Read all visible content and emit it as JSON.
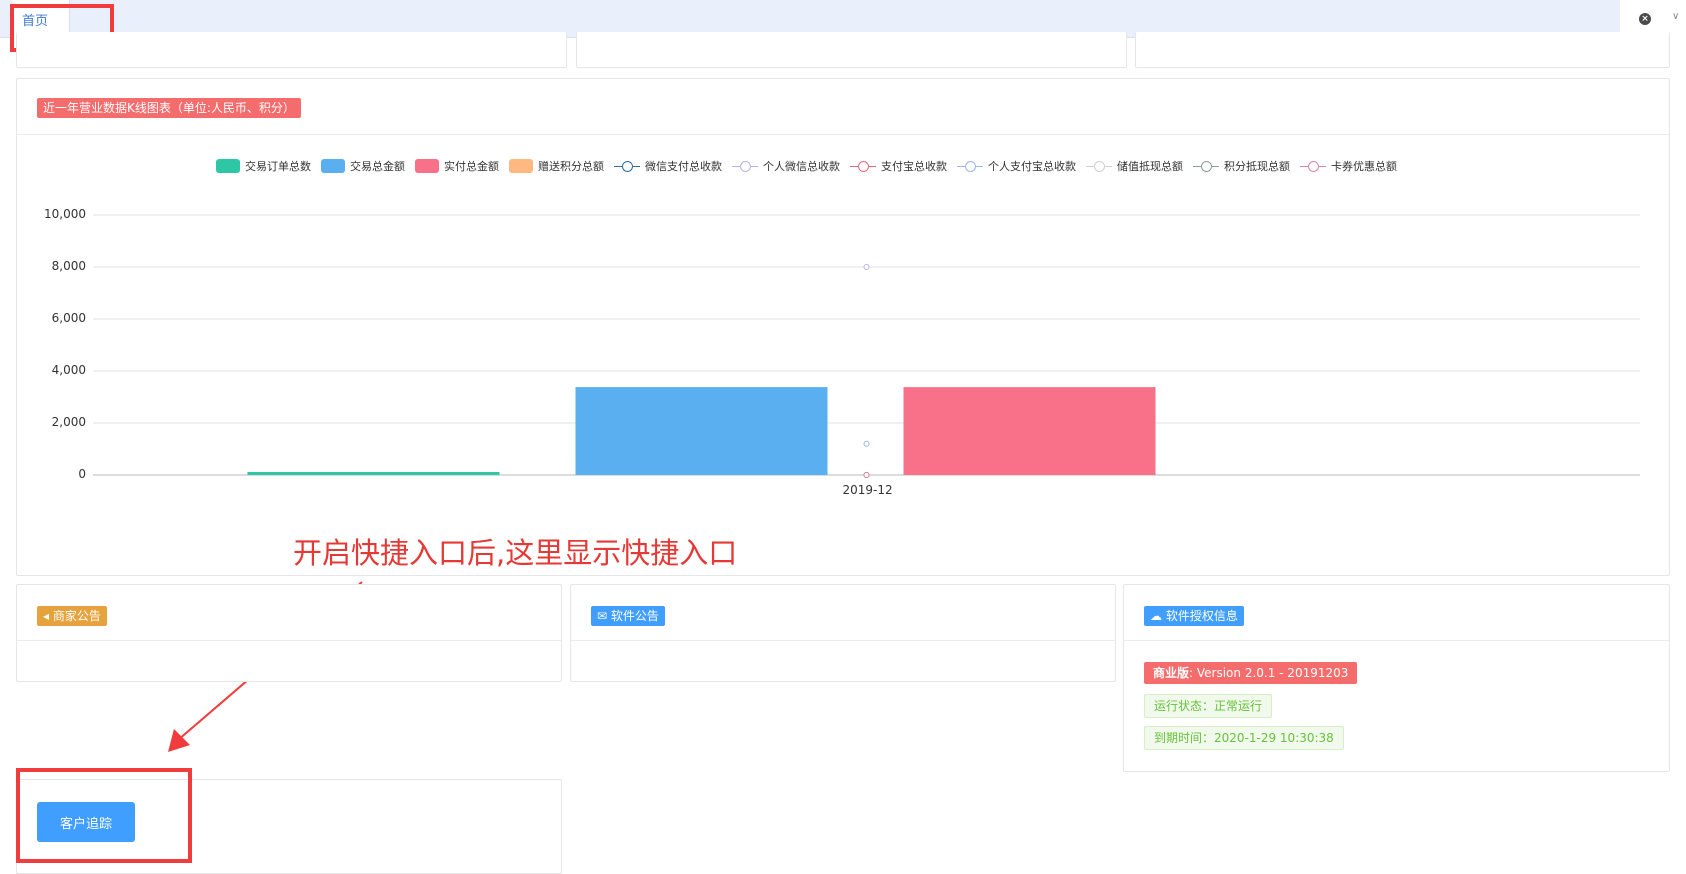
{
  "tabs": {
    "home_label": "首页",
    "close_icon": "close-circle-icon",
    "more_icon": "chevron-down-icon"
  },
  "chart_card": {
    "title": "近一年营业数据K线图表（单位:人民币、积分）"
  },
  "chart_data": {
    "type": "bar",
    "categories": [
      "2019-12"
    ],
    "ylim": [
      0,
      10000
    ],
    "yticks": [
      "10,000",
      "8,000",
      "6,000",
      "4,000",
      "2,000",
      "0"
    ],
    "grid": true,
    "legend_placement": "top-center",
    "series": [
      {
        "name": "交易订单总数",
        "kind": "bar",
        "color": "#2ec7a6",
        "values": [
          100
        ]
      },
      {
        "name": "交易总金额",
        "kind": "bar",
        "color": "#5aaff0",
        "values": [
          3380
        ]
      },
      {
        "name": "实付总金额",
        "kind": "bar",
        "color": "#f97089",
        "values": [
          3380
        ]
      },
      {
        "name": "赠送积分总额",
        "kind": "bar",
        "color": "#ffb980",
        "values": [
          0
        ]
      },
      {
        "name": "微信支付总收款",
        "kind": "line",
        "color": "#2d6f9e",
        "values": [
          0
        ]
      },
      {
        "name": "个人微信总收款",
        "kind": "line",
        "color": "#b7b3e6",
        "values": [
          8000
        ]
      },
      {
        "name": "支付宝总收款",
        "kind": "line",
        "color": "#e06b7e",
        "values": [
          0
        ]
      },
      {
        "name": "个人支付宝总收款",
        "kind": "line",
        "color": "#9bb6ea",
        "values": [
          1200
        ]
      },
      {
        "name": "储值抵现总额",
        "kind": "line",
        "color": "#d0d0d0",
        "values": [
          0
        ]
      },
      {
        "name": "积分抵现总额",
        "kind": "line",
        "color": "#8a9e94",
        "values": [
          0
        ]
      },
      {
        "name": "卡券优惠总额",
        "kind": "line",
        "color": "#d88aa4",
        "values": [
          0
        ]
      }
    ]
  },
  "annotation": {
    "text": "开启快捷入口后,这里显示快捷入口"
  },
  "merchant_notice": {
    "icon": "megaphone-icon",
    "title": "商家公告"
  },
  "software_notice": {
    "icon": "envelope-icon",
    "title": "软件公告"
  },
  "license": {
    "icon": "cloud-icon",
    "title": "软件授权信息",
    "edition_label": "商业版",
    "edition_value": ": Version 2.0.1 - 20191203",
    "status_text": "运行状态：正常运行",
    "expire_text": "到期时间：2020-1-29 10:30:38"
  },
  "quick_entry": {
    "button_label": "客户追踪"
  },
  "colors": {
    "accent": "#409eff",
    "danger": "#f56c6c",
    "warning": "#e6a23c",
    "success": "#67c23a",
    "annotation_red": "#e53935"
  }
}
